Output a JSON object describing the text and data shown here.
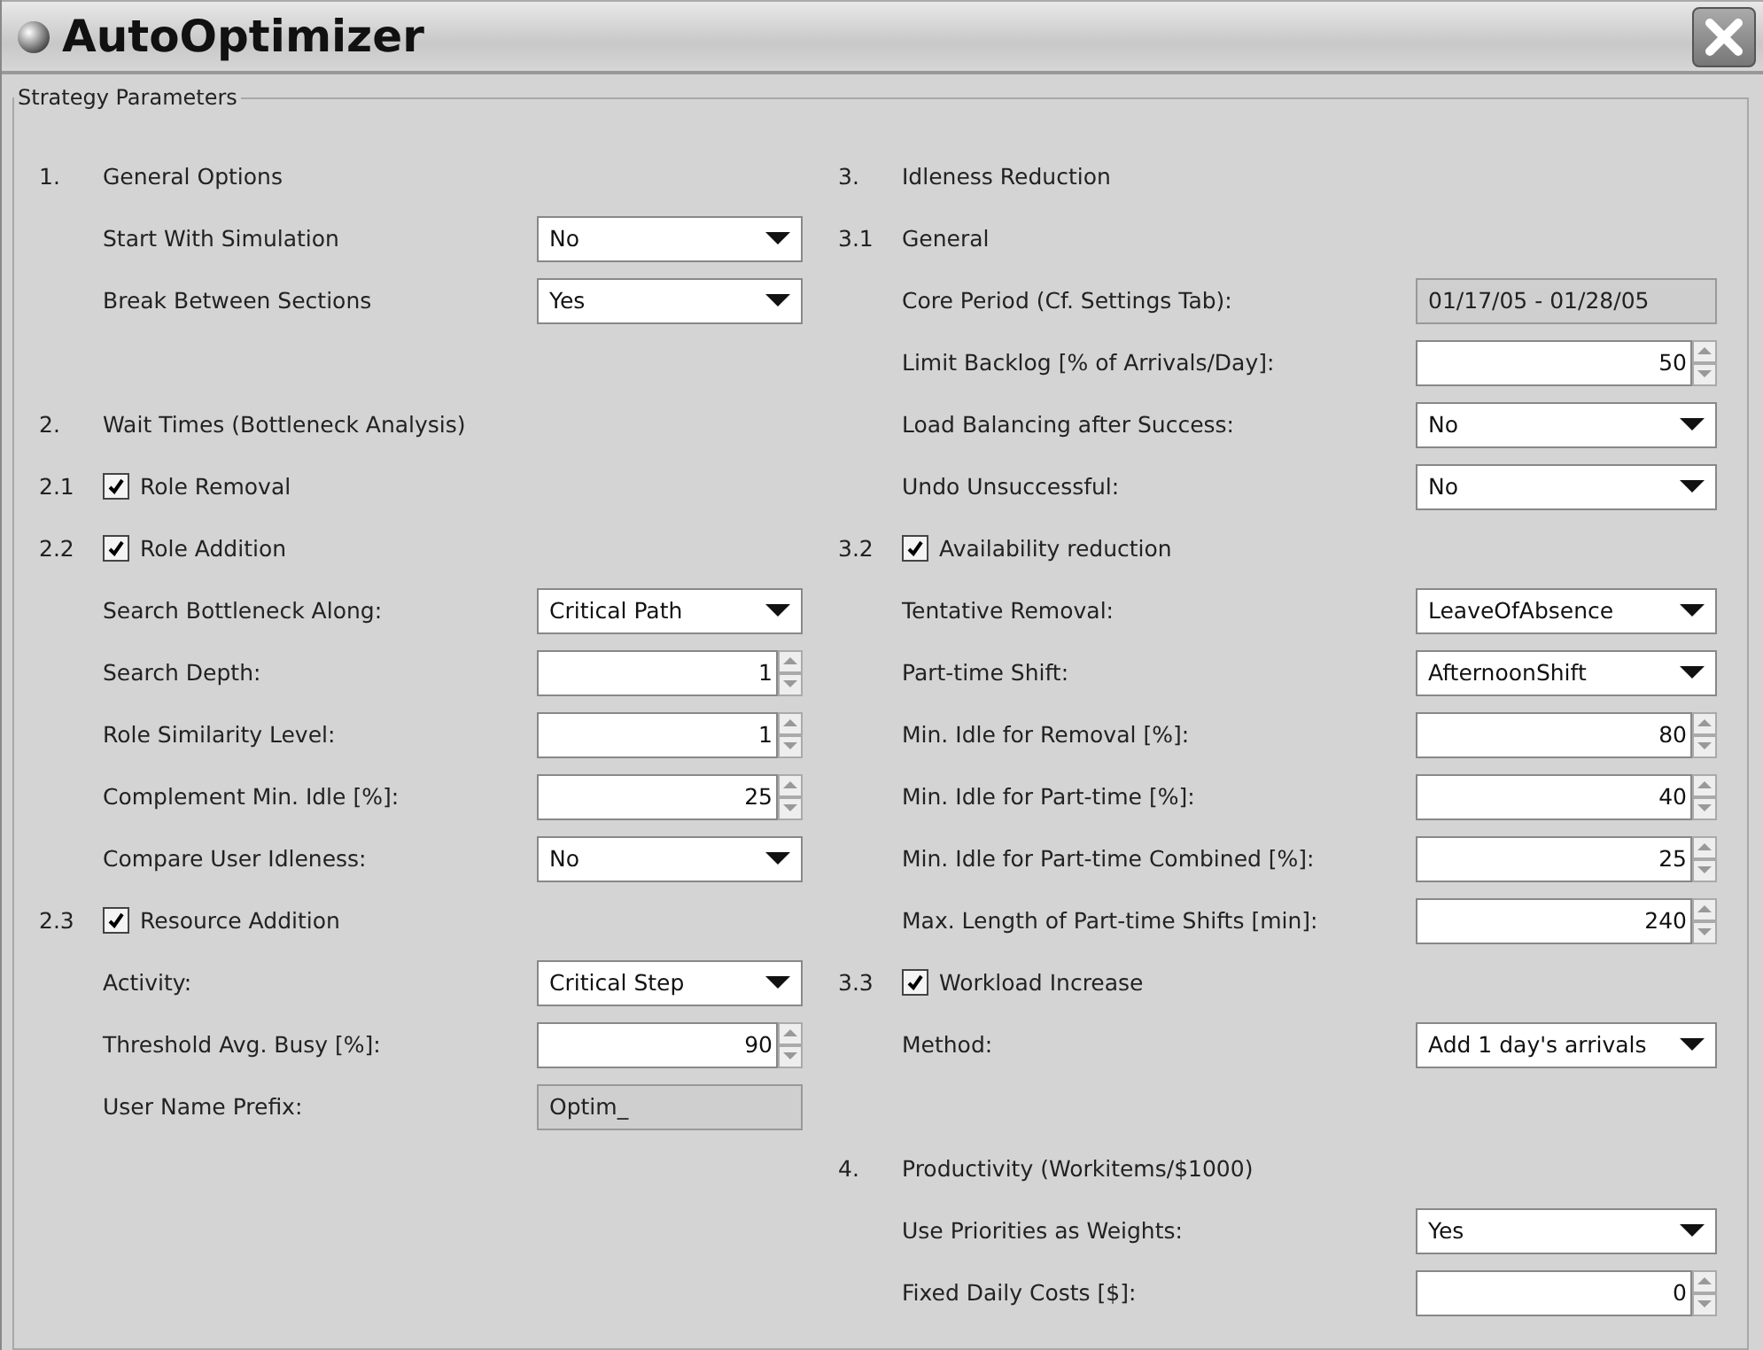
{
  "window": {
    "title": "AutoOptimizer"
  },
  "group": {
    "title": "Strategy Parameters"
  },
  "columns": [
    {
      "items": [
        {
          "kind": "heading",
          "number": "1.",
          "label": "General Options"
        },
        {
          "kind": "select",
          "label": "Start With Simulation",
          "value": "No"
        },
        {
          "kind": "select",
          "label": "Break Between Sections",
          "value": "Yes"
        },
        {
          "kind": "gap"
        },
        {
          "kind": "heading",
          "number": "2.",
          "label": "Wait Times (Bottleneck Analysis)"
        },
        {
          "kind": "check",
          "number": "2.1",
          "label": "Role Removal",
          "checked": true
        },
        {
          "kind": "check",
          "number": "2.2",
          "label": "Role Addition",
          "checked": true
        },
        {
          "kind": "select",
          "label": "Search Bottleneck Along:",
          "value": "Critical Path"
        },
        {
          "kind": "spin",
          "label": "Search Depth:",
          "value": "1"
        },
        {
          "kind": "spin",
          "label": "Role Similarity Level:",
          "value": "1"
        },
        {
          "kind": "spin",
          "label": "Complement Min. Idle [%]:",
          "value": "25"
        },
        {
          "kind": "select",
          "label": "Compare User Idleness:",
          "value": "No"
        },
        {
          "kind": "check",
          "number": "2.3",
          "label": "Resource Addition",
          "checked": true
        },
        {
          "kind": "select",
          "label": "Activity:",
          "value": "Critical Step"
        },
        {
          "kind": "spin",
          "label": "Threshold Avg. Busy [%]:",
          "value": "90"
        },
        {
          "kind": "readonly",
          "label": "User Name Prefix:",
          "value": "Optim_"
        }
      ]
    },
    {
      "items": [
        {
          "kind": "heading",
          "number": "3.",
          "label": "Idleness Reduction"
        },
        {
          "kind": "heading",
          "number": "3.1",
          "label": "General"
        },
        {
          "kind": "readonly",
          "label": "Core Period (Cf. Settings Tab):",
          "value": "01/17/05 - 01/28/05"
        },
        {
          "kind": "spin",
          "label": "Limit Backlog [% of Arrivals/Day]:",
          "value": "50"
        },
        {
          "kind": "select",
          "label": "Load Balancing after Success:",
          "value": "No"
        },
        {
          "kind": "select",
          "label": "Undo Unsuccessful:",
          "value": "No"
        },
        {
          "kind": "check",
          "number": "3.2",
          "label": "Availability reduction",
          "checked": true
        },
        {
          "kind": "select",
          "label": "Tentative Removal:",
          "value": "LeaveOfAbsence"
        },
        {
          "kind": "select",
          "label": "Part-time Shift:",
          "value": "AfternoonShift"
        },
        {
          "kind": "spin",
          "label": "Min. Idle for Removal [%]:",
          "value": "80"
        },
        {
          "kind": "spin",
          "label": "Min. Idle for Part-time [%]:",
          "value": "40"
        },
        {
          "kind": "spin",
          "label": "Min. Idle for Part-time Combined [%]:",
          "value": "25"
        },
        {
          "kind": "spin",
          "label": "Max. Length of Part-time Shifts [min]:",
          "value": "240"
        },
        {
          "kind": "check",
          "number": "3.3",
          "label": "Workload Increase",
          "checked": true
        },
        {
          "kind": "select",
          "label": "Method:",
          "value": "Add 1 day's arrivals"
        },
        {
          "kind": "gap"
        },
        {
          "kind": "heading",
          "number": "4.",
          "label": "Productivity (Workitems/$1000)"
        },
        {
          "kind": "select",
          "label": "Use Priorities as Weights:",
          "value": "Yes"
        },
        {
          "kind": "spin",
          "label": "Fixed Daily Costs [$]:",
          "value": "0"
        }
      ]
    }
  ]
}
